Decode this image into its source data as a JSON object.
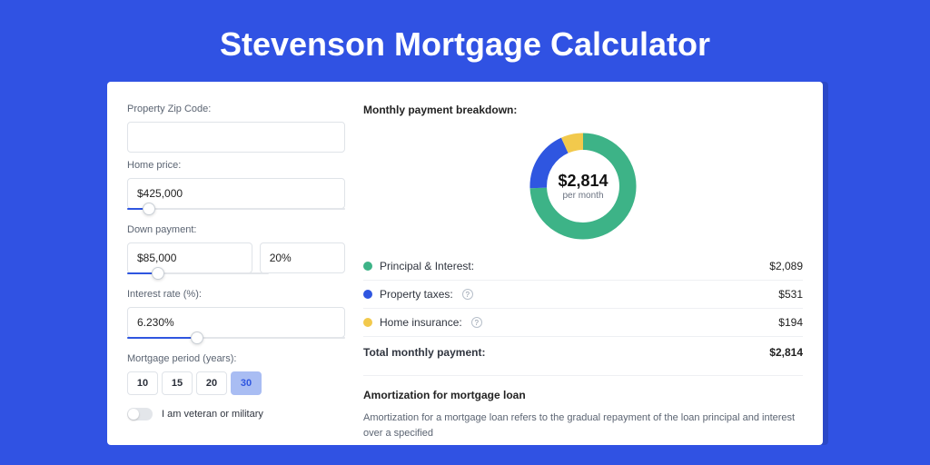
{
  "page": {
    "title": "Stevenson Mortgage Calculator"
  },
  "colors": {
    "principal": "#3db387",
    "taxes": "#2f56e0",
    "insurance": "#f2c94c"
  },
  "form": {
    "zip": {
      "label": "Property Zip Code:",
      "value": ""
    },
    "home_price": {
      "label": "Home price:",
      "value": "$425,000",
      "slider_pct": 10
    },
    "down_payment": {
      "label": "Down payment:",
      "amount": "$85,000",
      "pct": "20%",
      "slider_pct": 22
    },
    "interest": {
      "label": "Interest rate (%):",
      "value": "6.230%",
      "slider_pct": 32
    },
    "period": {
      "label": "Mortgage period (years):",
      "options": [
        "10",
        "15",
        "20",
        "30"
      ],
      "selected": "30"
    },
    "veteran": {
      "label": "I am veteran or military",
      "on": false
    }
  },
  "breakdown": {
    "title": "Monthly payment breakdown:",
    "center_value": "$2,814",
    "center_sub": "per month",
    "rows": [
      {
        "key": "principal",
        "label": "Principal & Interest:",
        "value": "$2,089",
        "info": false
      },
      {
        "key": "taxes",
        "label": "Property taxes:",
        "value": "$531",
        "info": true
      },
      {
        "key": "insurance",
        "label": "Home insurance:",
        "value": "$194",
        "info": true
      }
    ],
    "total": {
      "label": "Total monthly payment:",
      "value": "$2,814"
    }
  },
  "amort": {
    "title": "Amortization for mortgage loan",
    "body": "Amortization for a mortgage loan refers to the gradual repayment of the loan principal and interest over a specified"
  },
  "chart_data": {
    "type": "pie",
    "title": "Monthly payment breakdown",
    "categories": [
      "Principal & Interest",
      "Property taxes",
      "Home insurance"
    ],
    "values": [
      2089,
      531,
      194
    ],
    "series_colors": [
      "#3db387",
      "#2f56e0",
      "#f2c94c"
    ],
    "total": 2814,
    "center_label": "$2,814 per month"
  }
}
